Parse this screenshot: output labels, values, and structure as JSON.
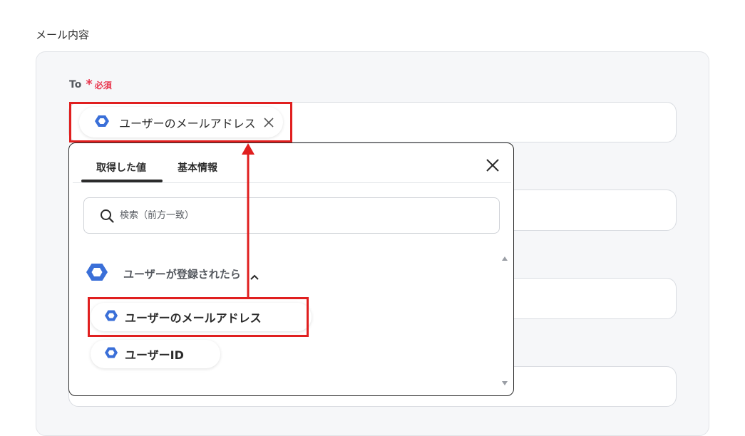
{
  "section": {
    "title": "メール内容"
  },
  "to_field": {
    "label": "To",
    "asterisk": "*",
    "required": "必須",
    "chip_label": "ユーザーのメールアドレス"
  },
  "popup": {
    "tabs": [
      {
        "label": "取得した値",
        "active": true
      },
      {
        "label": "基本情報",
        "active": false
      }
    ],
    "search_placeholder": "検索（前方一致）",
    "group": {
      "label": "ユーザーが登録されたら",
      "expanded": true,
      "items": [
        {
          "label": "ユーザーのメールアドレス"
        },
        {
          "label": "ユーザーID"
        }
      ]
    }
  },
  "icons": {
    "service": "google-workspace-hexagon-icon",
    "close": "close-icon",
    "search": "search-icon",
    "chevron": "chevron-up-icon"
  },
  "colors": {
    "accent_blue": "#3a6fd8",
    "required_red": "#e8384f",
    "highlight_red": "#e01f1f",
    "panel_bg": "#f6f7f9"
  }
}
